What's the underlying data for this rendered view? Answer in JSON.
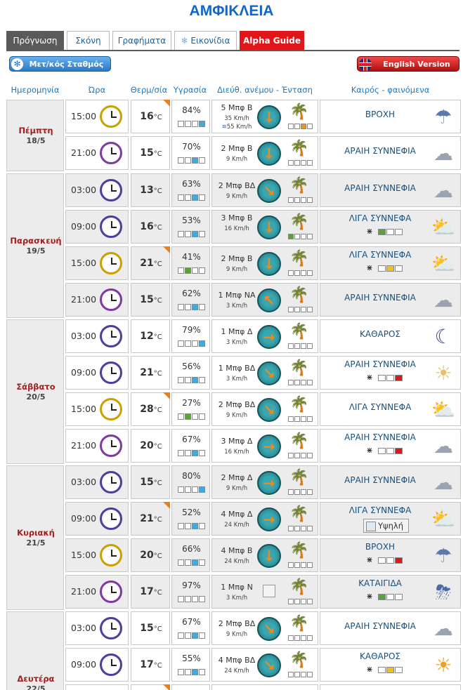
{
  "page": {
    "title": "ΑΜΦΙΚΛΕΙΑ"
  },
  "tabs": [
    {
      "label": "Πρόγνωση",
      "active": true
    },
    {
      "label": "Σκόνη",
      "active": false
    },
    {
      "label": "Γραφήματα",
      "active": false
    },
    {
      "label": "Εικονίδια",
      "active": false,
      "icon": "snowflake-icon"
    },
    {
      "label": "Alpha Guide",
      "active": false
    }
  ],
  "buttons": {
    "station": "Μετ/κός Σταθμός",
    "english": "English Version"
  },
  "columns": {
    "date": "Ημερομηνία",
    "time": "Ώρα",
    "temp": "Θερμ/σία",
    "humidity": "Υγρασία",
    "wind": "Διεύθ. ανέμου - Ένταση",
    "weather": "Καιρός - φαινόμενα"
  },
  "temp_unit": "°C",
  "colors": {
    "title": "#1166cc",
    "header": "#1d78be",
    "day_name": "#a31d1d",
    "alpha_tab": "#e0161b",
    "temp_marker": "#ef7d1a"
  },
  "days": [
    {
      "name": "Πέμπτη",
      "date": "18/5"
    },
    {
      "name": "Παρασκευή",
      "date": "19/5"
    },
    {
      "name": "Σάββατο",
      "date": "20/5"
    },
    {
      "name": "Κυριακή",
      "date": "21/5"
    },
    {
      "name": "Δευτέρα",
      "date": "22/5"
    }
  ],
  "rows": [
    {
      "time": "15:00",
      "temp": "16",
      "humidity": "84%",
      "wind": "5 Μπφ Β",
      "speed": "35 Km/h",
      "gust": "55 Km/h",
      "weather": "ΒΡΟΧΗ",
      "icon": "rain-icon"
    },
    {
      "time": "21:00",
      "temp": "15",
      "humidity": "70%",
      "wind": "2 Μπφ Β",
      "speed": "9 Km/h",
      "weather": "ΑΡΑΙΗ ΣΥΝΝΕΦΙΑ",
      "icon": "partly-cloudy-night-icon"
    },
    {
      "time": "03:00",
      "temp": "13",
      "humidity": "63%",
      "wind": "2 Μπφ ΒΔ",
      "speed": "9 Km/h",
      "weather": "ΑΡΑΙΗ ΣΥΝΝΕΦΙΑ",
      "icon": "partly-cloudy-night-icon"
    },
    {
      "time": "09:00",
      "temp": "16",
      "humidity": "53%",
      "wind": "3 Μπφ Β",
      "speed": "16 Km/h",
      "weather": "ΛΙΓΑ ΣΥΝΝΕΦΑ",
      "icon": "sun-cloud-icon"
    },
    {
      "time": "15:00",
      "temp": "21",
      "humidity": "41%",
      "wind": "2 Μπφ Β",
      "speed": "9 Km/h",
      "weather": "ΛΙΓΑ ΣΥΝΝΕΦΑ",
      "icon": "sun-cloud-icon"
    },
    {
      "time": "21:00",
      "temp": "15",
      "humidity": "62%",
      "wind": "1 Μπφ ΝΑ",
      "speed": "3 Km/h",
      "weather": "ΑΡΑΙΗ ΣΥΝΝΕΦΙΑ",
      "icon": "partly-cloudy-night-icon"
    },
    {
      "time": "03:00",
      "temp": "12",
      "humidity": "79%",
      "wind": "1 Μπφ Δ",
      "speed": "3 Km/h",
      "weather": "ΚΑΘΑΡΟΣ",
      "icon": "moon-icon"
    },
    {
      "time": "09:00",
      "temp": "21",
      "humidity": "56%",
      "wind": "1 Μπφ ΒΔ",
      "speed": "3 Km/h",
      "weather": "ΑΡΑΙΗ ΣΥΝΝΕΦΙΑ",
      "icon": "hazy-sun-icon"
    },
    {
      "time": "15:00",
      "temp": "28",
      "humidity": "27%",
      "wind": "2 Μπφ ΒΔ",
      "speed": "9 Km/h",
      "weather": "ΛΙΓΑ ΣΥΝΝΕΦΑ",
      "icon": "sun-cloud-icon"
    },
    {
      "time": "21:00",
      "temp": "20",
      "humidity": "67%",
      "wind": "3 Μπφ Δ",
      "speed": "16 Km/h",
      "weather": "ΑΡΑΙΗ ΣΥΝΝΕΦΙΑ",
      "icon": "partly-cloudy-night-icon"
    },
    {
      "time": "03:00",
      "temp": "15",
      "humidity": "80%",
      "wind": "2 Μπφ Δ",
      "speed": "9 Km/h",
      "weather": "ΑΡΑΙΗ ΣΥΝΝΕΦΙΑ",
      "icon": "partly-cloudy-night-icon"
    },
    {
      "time": "09:00",
      "temp": "21",
      "humidity": "52%",
      "wind": "4 Μπφ Δ",
      "speed": "24 Km/h",
      "weather": "ΛΙΓΑ ΣΥΝΝΕΦΑ",
      "uv": "Υψηλή",
      "icon": "sun-cloud-icon"
    },
    {
      "time": "15:00",
      "temp": "20",
      "humidity": "66%",
      "wind": "4 Μπφ Β",
      "speed": "24 Km/h",
      "weather": "ΒΡΟΧΗ",
      "icon": "rain-icon"
    },
    {
      "time": "21:00",
      "temp": "17",
      "humidity": "97%",
      "wind": "1 Μπφ Ν",
      "speed": "3 Km/h",
      "weather": "ΚΑΤΑΙΓΙΔΑ",
      "icon": "storm-icon"
    },
    {
      "time": "03:00",
      "temp": "15",
      "humidity": "67%",
      "wind": "2 Μπφ ΒΔ",
      "speed": "9 Km/h",
      "weather": "ΑΡΑΙΗ ΣΥΝΝΕΦΙΑ",
      "icon": "partly-cloudy-night-icon"
    },
    {
      "time": "09:00",
      "temp": "17",
      "humidity": "55%",
      "wind": "4 Μπφ ΒΔ",
      "speed": "24 Km/h",
      "weather": "ΚΑΘΑΡΟΣ",
      "icon": "sun-icon"
    }
  ]
}
